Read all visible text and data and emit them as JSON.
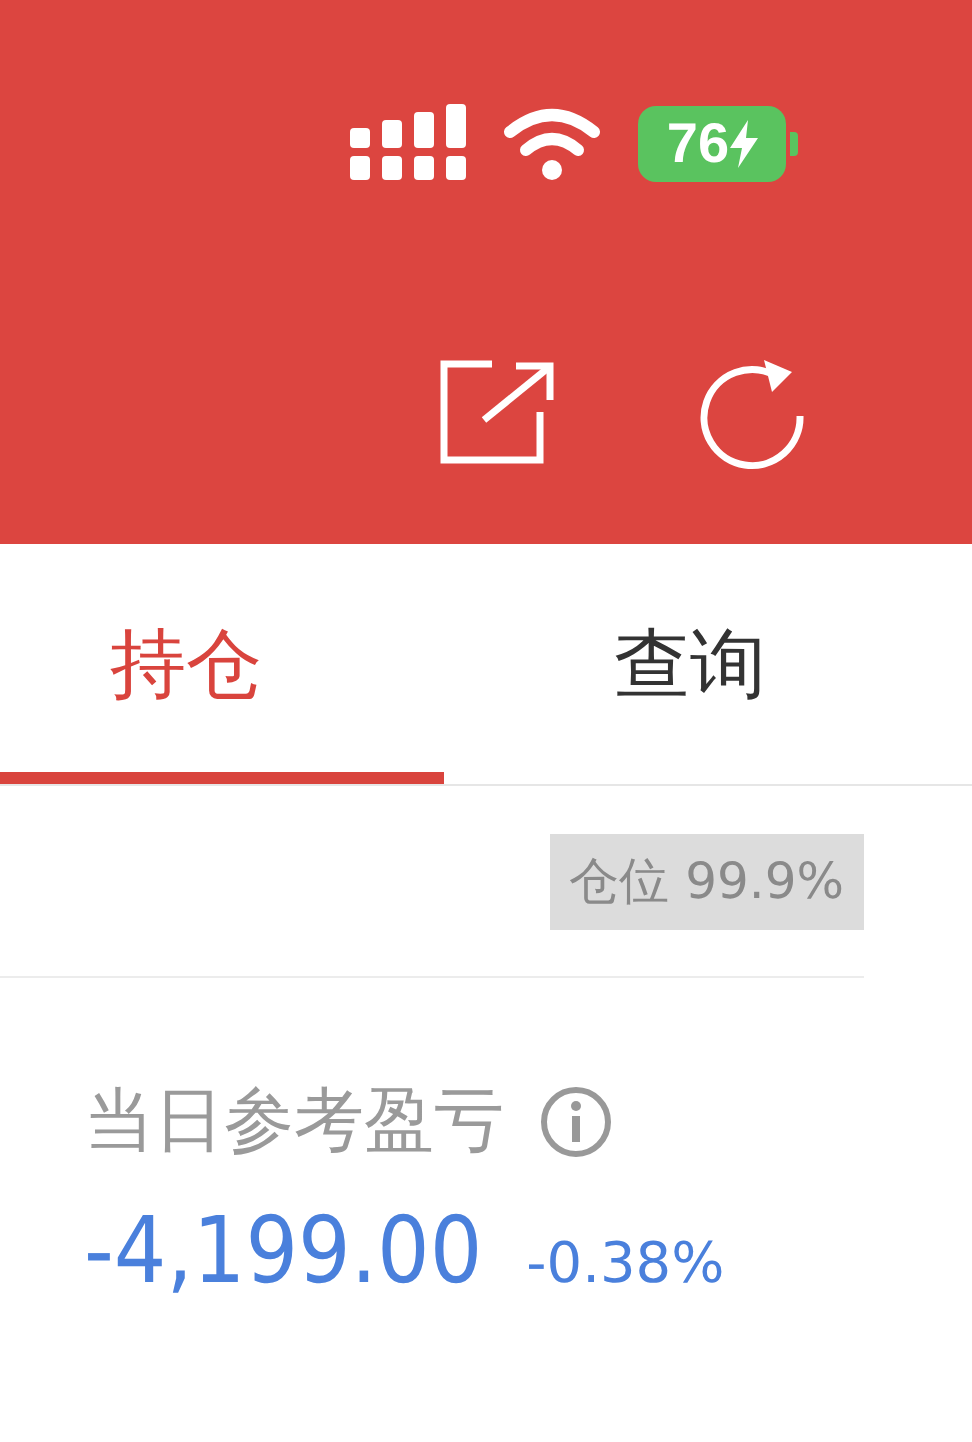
{
  "status_bar": {
    "battery": "76",
    "charging": true
  },
  "tabs": [
    {
      "label": "持仓",
      "selected": true
    },
    {
      "label": "查询",
      "selected": false
    }
  ],
  "position": {
    "text": "仓位 99.9%"
  },
  "daily_pnl": {
    "label": "当日参考盈亏",
    "value": "-4,199.00",
    "percent": "-0.38%"
  }
}
